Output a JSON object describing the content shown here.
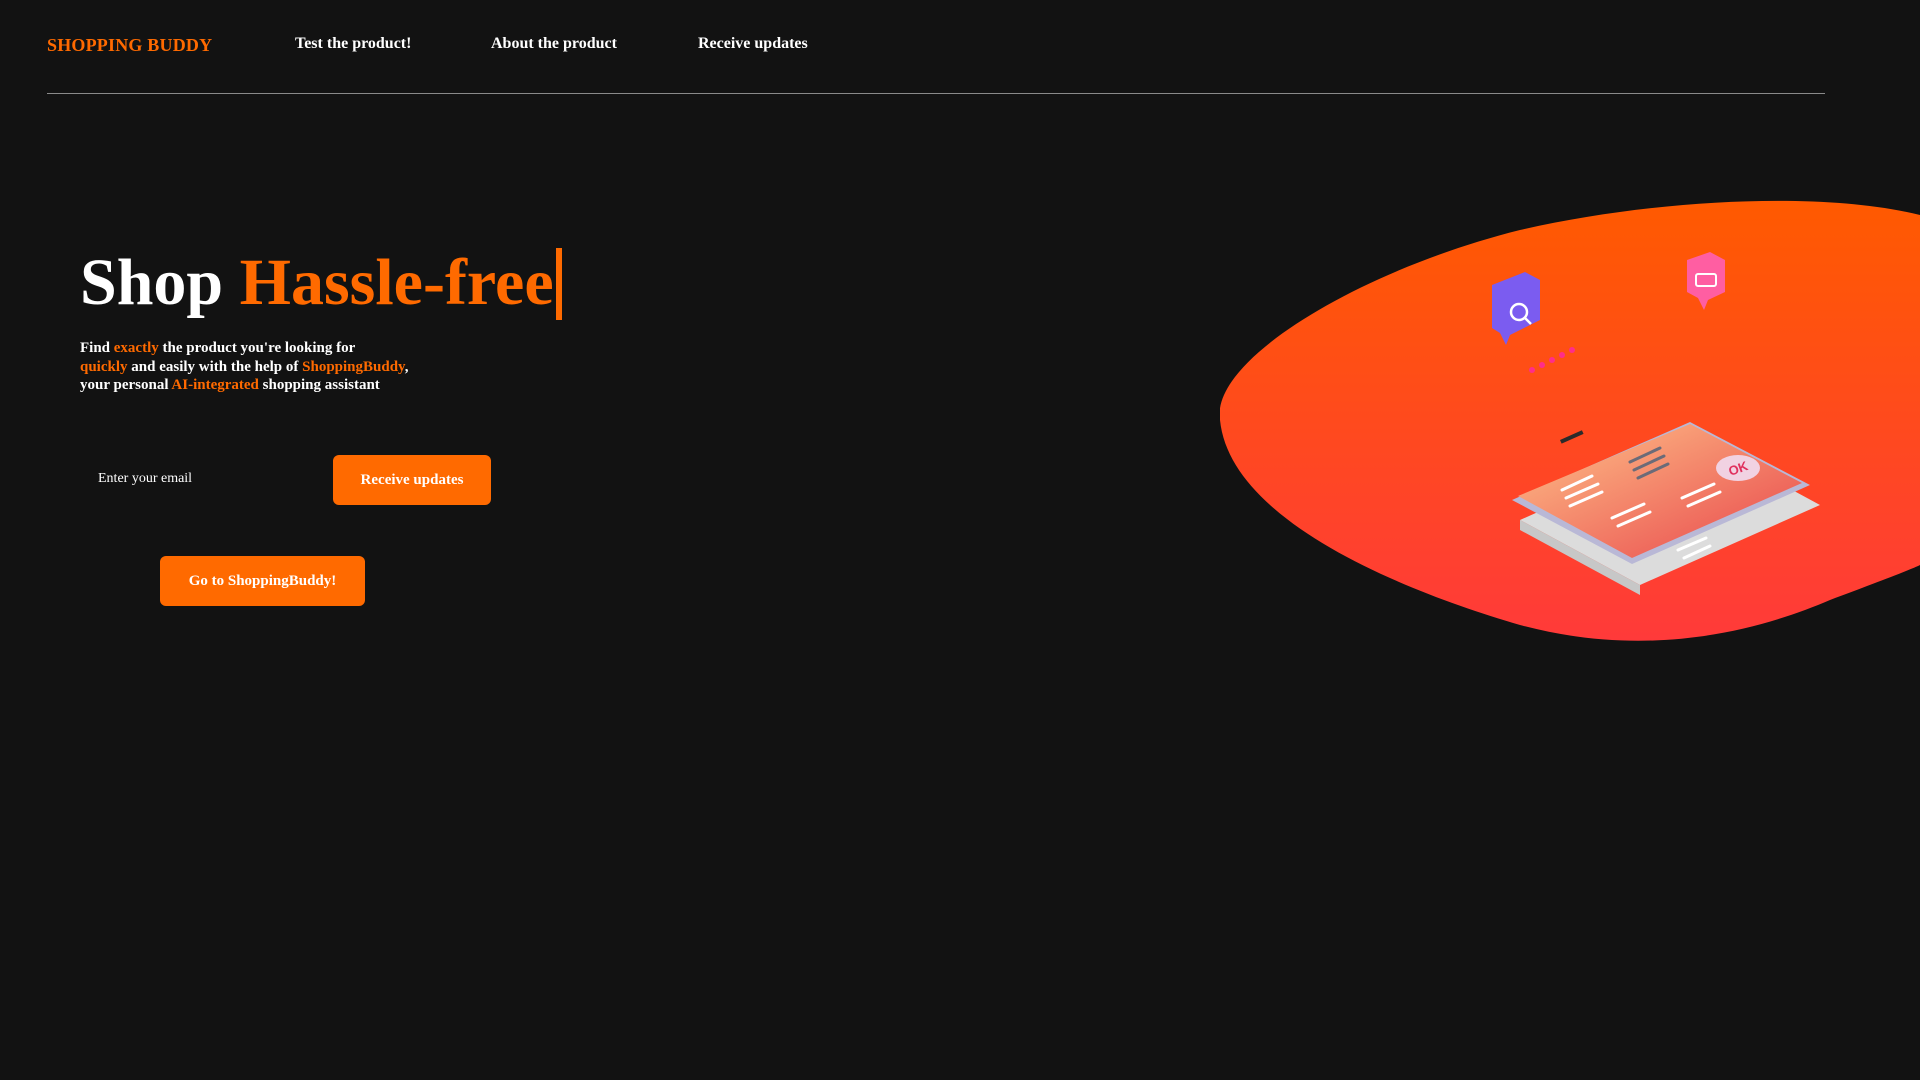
{
  "nav": {
    "logo": "SHOPPING BUDDY",
    "links": [
      "Test the product!",
      "About the product",
      "Receive updates"
    ]
  },
  "hero": {
    "title_part1": "Shop",
    "title_part2": "Hassle-free",
    "tagline": {
      "t1": "Find ",
      "h1": "exactly",
      "t2": " the product you're looking for",
      "h2": "quickly",
      "t3": " and easily with the help of ",
      "h3": "ShoppingBuddy",
      "t4": ",",
      "t5": "your personal ",
      "h4": "AI-integrated",
      "t6": " shopping assistant"
    },
    "email_placeholder": "Enter your email",
    "receive_button": "Receive updates",
    "go_button": "Go to ShoppingBuddy!",
    "phone_badge": "OK"
  },
  "colors": {
    "accent": "#ff6a00",
    "background": "#121212",
    "blob_top": "#ff5a00",
    "blob_bottom": "#ff3a3a"
  }
}
